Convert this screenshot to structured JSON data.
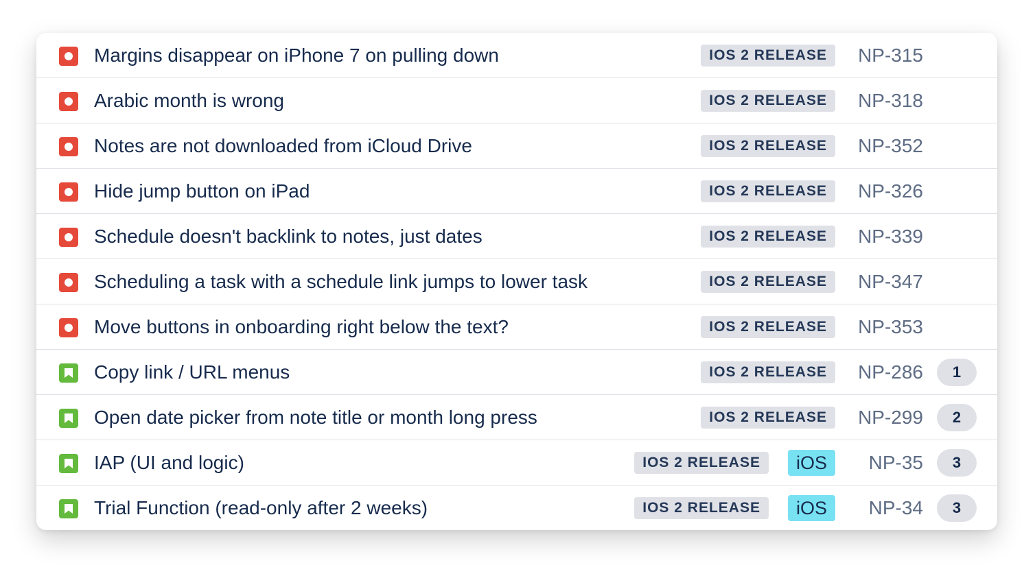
{
  "issues": [
    {
      "type": "bug",
      "icon": "bug-icon",
      "summary": "Margins disappear on iPhone 7 on pulling down",
      "epic": "IOS 2 RELEASE",
      "label": "",
      "key": "NP-315",
      "count": ""
    },
    {
      "type": "bug",
      "icon": "bug-icon",
      "summary": "Arabic month is wrong",
      "epic": "IOS 2 RELEASE",
      "label": "",
      "key": "NP-318",
      "count": ""
    },
    {
      "type": "bug",
      "icon": "bug-icon",
      "summary": "Notes are not downloaded from iCloud Drive",
      "epic": "IOS 2 RELEASE",
      "label": "",
      "key": "NP-352",
      "count": ""
    },
    {
      "type": "bug",
      "icon": "bug-icon",
      "summary": "Hide jump button on iPad",
      "epic": "IOS 2 RELEASE",
      "label": "",
      "key": "NP-326",
      "count": ""
    },
    {
      "type": "bug",
      "icon": "bug-icon",
      "summary": "Schedule doesn't backlink to notes, just dates",
      "epic": "IOS 2 RELEASE",
      "label": "",
      "key": "NP-339",
      "count": ""
    },
    {
      "type": "bug",
      "icon": "bug-icon",
      "summary": "Scheduling a task with a schedule link jumps to lower task",
      "epic": "IOS 2 RELEASE",
      "label": "",
      "key": "NP-347",
      "count": ""
    },
    {
      "type": "bug",
      "icon": "bug-icon",
      "summary": "Move buttons in onboarding right below the text?",
      "epic": "IOS 2 RELEASE",
      "label": "",
      "key": "NP-353",
      "count": ""
    },
    {
      "type": "story",
      "icon": "bookmark-icon",
      "summary": "Copy link / URL menus",
      "epic": "IOS 2 RELEASE",
      "label": "",
      "key": "NP-286",
      "count": "1"
    },
    {
      "type": "story",
      "icon": "bookmark-icon",
      "summary": "Open date picker from note title or month long press",
      "epic": "IOS 2 RELEASE",
      "label": "",
      "key": "NP-299",
      "count": "2"
    },
    {
      "type": "story",
      "icon": "bookmark-icon",
      "summary": "IAP (UI and logic)",
      "epic": "IOS 2 RELEASE",
      "label": "iOS",
      "key": "NP-35",
      "count": "3"
    },
    {
      "type": "story",
      "icon": "bookmark-icon",
      "summary": "Trial Function (read-only after 2 weeks)",
      "epic": "IOS 2 RELEASE",
      "label": "iOS",
      "key": "NP-34",
      "count": "3"
    }
  ],
  "colors": {
    "bug": "#e5493a",
    "story": "#63ba3c",
    "epic_bg": "#dfe1e6",
    "label_bg": "#79e2f2",
    "text": "#172b4d",
    "key": "#5e6c84"
  }
}
